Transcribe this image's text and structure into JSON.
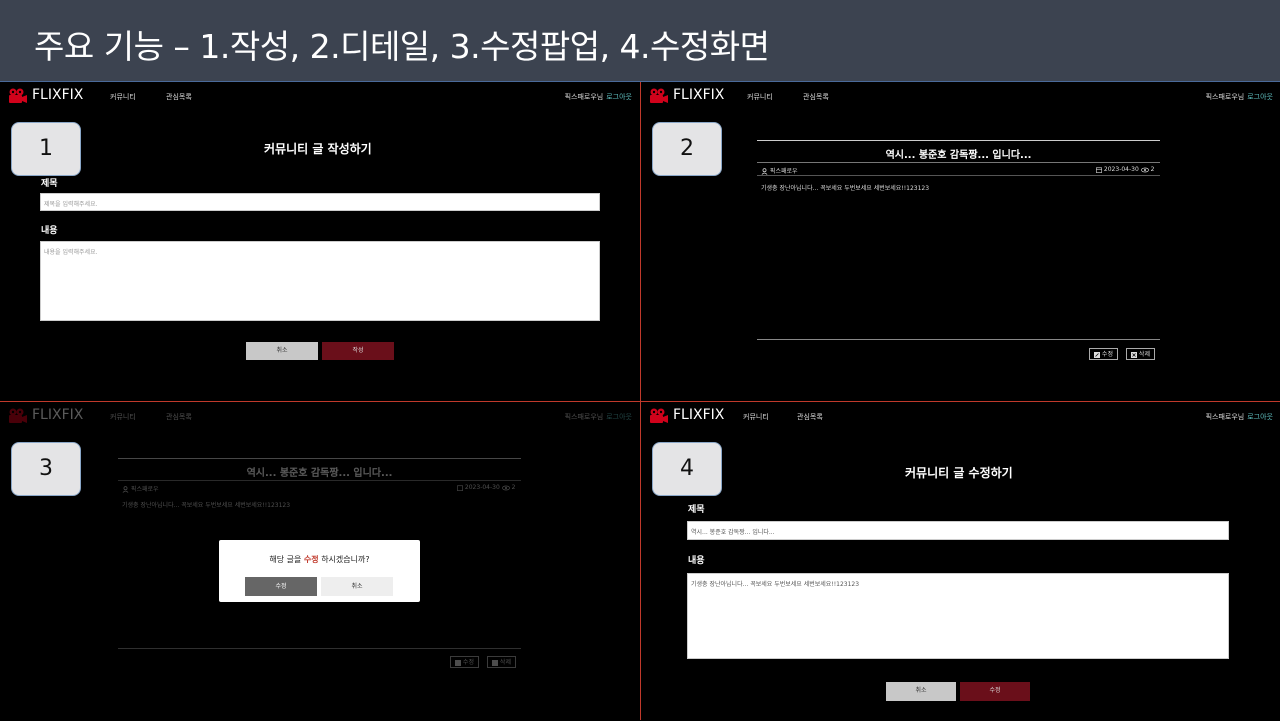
{
  "slide": {
    "title": "주요 기능 – 1.작성, 2.디테일, 3.수정팝업, 4.수정화면"
  },
  "nav": {
    "logo": "FLIXFIX",
    "community": "커뮤니티",
    "watchlist": "관심목록",
    "user": "픽스패로우님",
    "logout": "로그아웃"
  },
  "panel1": {
    "step": "1",
    "form_title": "커뮤니티 글 작성하기",
    "title_label": "제목",
    "title_placeholder": "제목을 입력해주세요.",
    "content_label": "내용",
    "content_placeholder": "내용을 입력해주세요.",
    "cancel": "취소",
    "submit": "작성"
  },
  "panel2": {
    "step": "2",
    "post_title": "역시... 봉준호 감독짱... 입니다...",
    "author": "픽스패로우",
    "date": "2023-04-30",
    "views": "2",
    "content": "기생충 장난아닙니다... 꼭보세요 두번보세요 세번보세요!!123123",
    "edit": "수정",
    "delete": "삭제"
  },
  "panel3": {
    "step": "3",
    "modal_prefix": "해당 글을 ",
    "modal_highlight": "수정",
    "modal_suffix": " 하시겠습니까?",
    "confirm": "수정",
    "cancel": "취소"
  },
  "panel4": {
    "step": "4",
    "form_title": "커뮤니티 글 수정하기",
    "title_label": "제목",
    "title_value": "역시... 봉준호 감독짱... 입니다...",
    "content_label": "내용",
    "content_value": "기생충 장난아닙니다... 꼭보세요 두번보세요 세번보세요!!123123",
    "cancel": "취소",
    "submit": "수정"
  },
  "colors": {
    "accent": "#6a0f1a",
    "header_bg": "#3c4350",
    "divider": "#c0392b",
    "logout": "#5fbfc0"
  }
}
